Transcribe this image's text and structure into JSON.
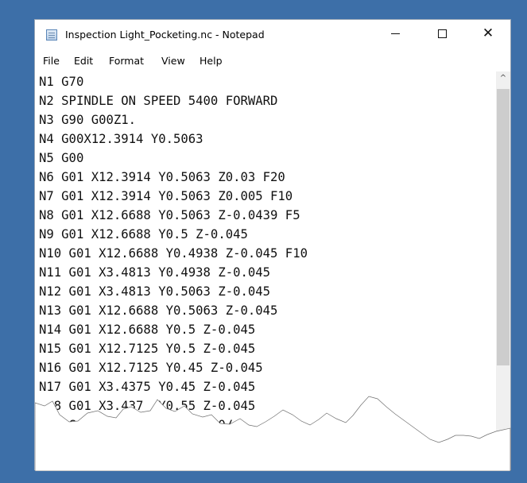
{
  "window": {
    "title": "Inspection Light_Pocketing.nc - Notepad",
    "controls": {
      "minimize": "—",
      "maximize": "□",
      "close": "✕"
    }
  },
  "menu": [
    "File",
    "Edit",
    "Format",
    "View",
    "Help"
  ],
  "lines": [
    "N1 G70",
    "N2 SPINDLE ON SPEED 5400 FORWARD",
    "N3 G90 G00Z1.",
    "N4 G00X12.3914 Y0.5063",
    "N5 G00",
    "N6 G01 X12.3914 Y0.5063 Z0.03 F20",
    "N7 G01 X12.3914 Y0.5063 Z0.005 F10",
    "N8 G01 X12.6688 Y0.5063 Z-0.0439 F5",
    "N9 G01 X12.6688 Y0.5 Z-0.045",
    "N10 G01 X12.6688 Y0.4938 Z-0.045 F10",
    "N11 G01 X3.4813 Y0.4938 Z-0.045",
    "N12 G01 X3.4813 Y0.5063 Z-0.045",
    "N13 G01 X12.6688 Y0.5063 Z-0.045",
    "N14 G01 X12.6688 Y0.5 Z-0.045",
    "N15 G01 X12.7125 Y0.5 Z-0.045",
    "N16 G01 X12.7125 Y0.45 Z-0.045",
    "N17 G01 X3.4375 Y0.45 Z-0.045",
    "  8 G01 X3.437  Y0.55 Z-0.045",
    "    G01         .55   ).0/"
  ],
  "scrollbar": {
    "up_arrow": "^"
  },
  "icons": [
    "notepad-icon",
    "minimize-icon",
    "maximize-icon",
    "close-icon",
    "scroll-up-icon"
  ]
}
